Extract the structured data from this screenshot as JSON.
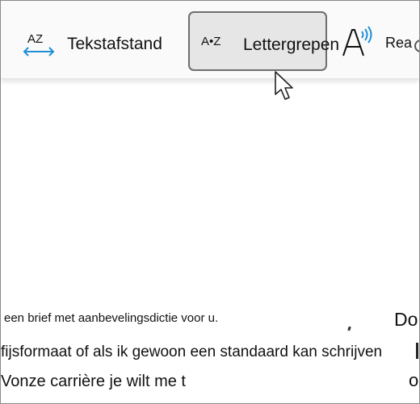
{
  "toolbar": {
    "text_spacing": {
      "icon_text": "AZ",
      "label": "Tekstafstand",
      "icon": "text-spacing-icon"
    },
    "syllables": {
      "icon_text": "A•Z",
      "label": "Lettergrepen",
      "icon": "syllables-icon",
      "state": "hovered"
    },
    "read_aloud": {
      "label": "Rea",
      "icon": "read-aloud-icon"
    }
  },
  "document": {
    "line1": "een brief met aanbevelingsdictie voor u.",
    "line2": "fijsformaat of als ik gewoon een standaard kan schrijven",
    "line3": "Vonze carrière je wilt me t",
    "right_top": "Do",
    "right_bottom": "o"
  },
  "colors": {
    "accent": "#1f8fd6",
    "hover_bg": "#e6e6e6"
  }
}
